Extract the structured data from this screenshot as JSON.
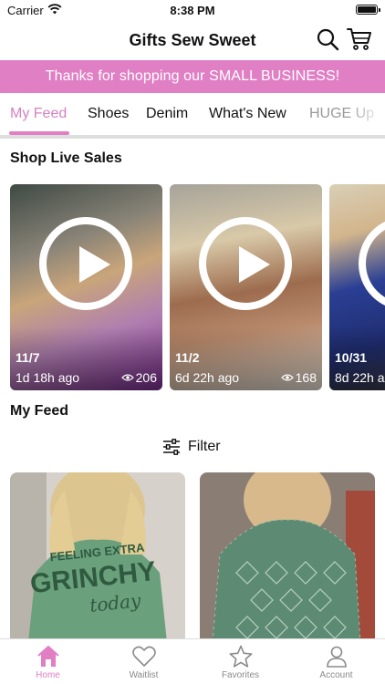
{
  "status_bar": {
    "carrier": "Carrier",
    "time": "8:38 PM"
  },
  "header": {
    "title": "Gifts Sew Sweet",
    "search_icon": "search-icon",
    "cart_icon": "cart-icon"
  },
  "banner": {
    "text": "Thanks for shopping our SMALL BUSINESS!",
    "color": "#e07fc4"
  },
  "tabs": [
    {
      "label": "My Feed",
      "active": true
    },
    {
      "label": "Shoes"
    },
    {
      "label": "Denim"
    },
    {
      "label": "What's New"
    },
    {
      "label": "HUGE Up"
    }
  ],
  "live_sales": {
    "title": "Shop Live Sales",
    "cards": [
      {
        "date": "11/7",
        "ago": "1d 18h ago",
        "views": "206"
      },
      {
        "date": "11/2",
        "ago": "6d 22h ago",
        "views": "168"
      },
      {
        "date": "10/31",
        "ago": "8d 22h a"
      }
    ]
  },
  "feed": {
    "title": "My Feed",
    "filter_label": "Filter"
  },
  "bottom_nav": [
    {
      "label": "Home",
      "icon": "home-icon",
      "active": true
    },
    {
      "label": "Waitlist",
      "icon": "heart-icon"
    },
    {
      "label": "Favorites",
      "icon": "star-icon"
    },
    {
      "label": "Account",
      "icon": "person-icon"
    }
  ],
  "colors": {
    "accent": "#e07fc4",
    "active_tab": "#d680c2"
  }
}
